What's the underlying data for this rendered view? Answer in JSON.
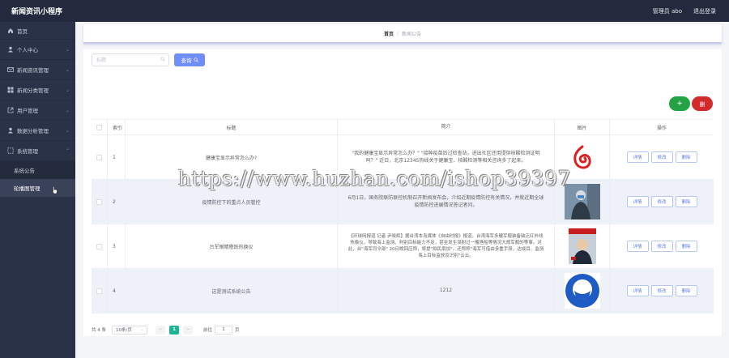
{
  "app": {
    "title": "新闻资讯小程序"
  },
  "header": {
    "admin_label": "管理员 abo",
    "logout": "退出登录"
  },
  "sidebar": {
    "items": [
      {
        "label": "首页",
        "icon": "home-icon"
      },
      {
        "label": "个人中心",
        "icon": "user-icon"
      },
      {
        "label": "新闻资讯管理",
        "icon": "mail-icon"
      },
      {
        "label": "新闻分类管理",
        "icon": "grid-icon"
      },
      {
        "label": "用户管理",
        "icon": "external-icon"
      },
      {
        "label": "数据分析管理",
        "icon": "user-icon"
      },
      {
        "label": "系统管理",
        "icon": "settings-icon"
      }
    ],
    "sub_items": [
      {
        "label": "系统公告"
      },
      {
        "label": "轮播图管理"
      }
    ]
  },
  "breadcrumb": {
    "home": "首页",
    "separator": "/",
    "current": "新闻公告"
  },
  "search": {
    "placeholder": "标题",
    "button": "查询"
  },
  "actions": {
    "add": "+",
    "delete": "删"
  },
  "table": {
    "headers": {
      "index": "索引",
      "title": "标题",
      "intro": "简介",
      "image": "图片",
      "ops": "操作"
    },
    "rows": [
      {
        "index": "1",
        "title": "健康宝显示异常怎么办?",
        "intro": "\"我的健康宝显示异常怎么办？\" \"接种疫苗后过检查站，进出社区还用提供核酸检测证明吗？\" 近日，北京12345热线关于健康宝、核酸检测等相关咨询多了起来。",
        "image": "logo-icon"
      },
      {
        "index": "2",
        "title": "疫情防控下的重点人员管控",
        "intro": "6月1日，国务院联防联控机制召开新闻发布会，介绍近期疫情防控有关情况，并就近期全球疫情防控进展情况答记者问。",
        "image": "doctor-photo"
      },
      {
        "index": "3",
        "title": "台军眼睛瞪跃热换仪",
        "intro": "【环球网报道 记者 尹晓辉】据台湾本岛媒体《自由时报》报道，台湾海军多艘军舰装备缺乏红外线热像仪，导致海上监测、判别目标能力不足，甚至发生误射过一艘渔船等情况大规军舰的等事。对此，台\"海军司令部\" 20日晚回应称，将提\"拟民扇加\"，还称称\"海军可借由多重手段，达成目、监测海上目标监放及识别\"云云。",
        "image": "magazine-cover"
      },
      {
        "index": "4",
        "title": "这是测试系统公告",
        "intro": "1212",
        "image": "mask-icon"
      }
    ],
    "op_labels": {
      "detail": "详情",
      "edit": "修改",
      "remove": "删除"
    }
  },
  "pagination": {
    "total": "共 4 条",
    "page_size": "10条/页",
    "prev": "<",
    "current": "1",
    "next": ">",
    "goto_label": "前往",
    "goto_value": "1",
    "goto_suffix": "页"
  },
  "watermark": "https://www.huzhan.com/ishop39397",
  "colors": {
    "topbar": "#232a3d",
    "sidebar": "#2a3247",
    "primary": "#6f8ef7",
    "success": "#25a244",
    "danger": "#d12b2b",
    "pager_active": "#1bb595"
  }
}
